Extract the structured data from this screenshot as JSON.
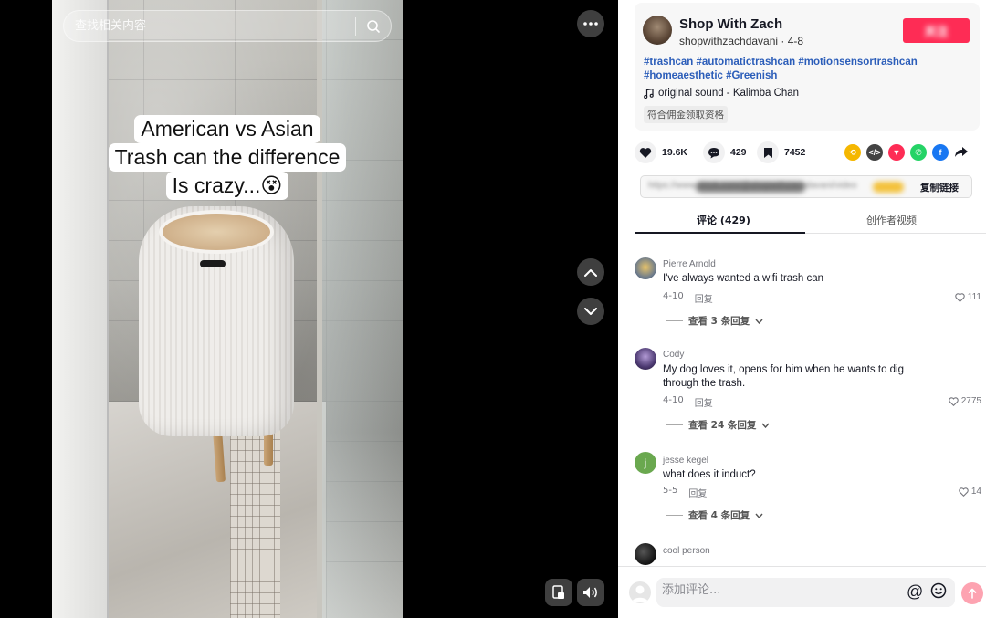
{
  "search": {
    "placeholder": "查找相关内容"
  },
  "video": {
    "caption_lines": [
      "American vs Asian",
      "Trash can the difference",
      "Is crazy...😵"
    ]
  },
  "author": {
    "name": "Shop With Zach",
    "handle_date": "shopwithzachdavani · 4-8",
    "follow_label": "关注"
  },
  "post": {
    "hashtags": "#trashcan #automatictrashcan #motionsensortrashcan #homeaesthetic #Greenish",
    "sound": "original sound - Kalimba Chan",
    "commission_tag": "符合佣金领取资格"
  },
  "stats": {
    "likes": "19.6K",
    "comments": "429",
    "saves": "7452"
  },
  "link_box": {
    "copy_label": "复制链接",
    "url": "https://www.tiktok.com/@shopwithzachdavani/video"
  },
  "tabs": {
    "comments": "评论 (429)",
    "creator": "创作者视频"
  },
  "comments": [
    {
      "user": "Pierre Arnold",
      "text": "I've always wanted a wifi trash can",
      "date": "4-10",
      "reply": "回复",
      "likes": "111",
      "view_replies": "查看 3 条回复"
    },
    {
      "user": "Cody",
      "text": "My dog loves it, opens for him when he wants to dig through the trash.",
      "date": "4-10",
      "reply": "回复",
      "likes": "2775",
      "view_replies": "查看 24 条回复"
    },
    {
      "user": "jesse kegel",
      "text": "what does it induct?",
      "date": "5-5",
      "reply": "回复",
      "likes": "14",
      "view_replies": "查看 4 条回复",
      "avatar_letter": "j"
    },
    {
      "user": "cool person"
    }
  ],
  "comment_bar": {
    "placeholder": "添加评论..."
  },
  "colors": {
    "accent": "#fe2c55",
    "hashtag": "#2b5db9",
    "jesse_avatar": "#6aa84f"
  }
}
